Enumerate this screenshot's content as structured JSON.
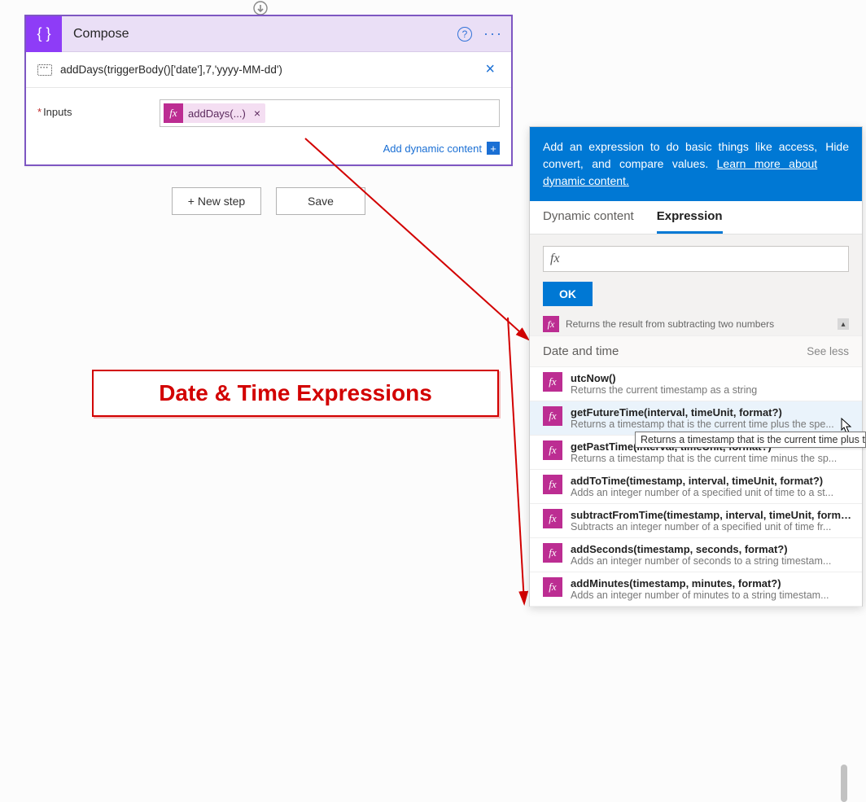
{
  "connector_symbol": "⇣",
  "compose_card": {
    "title": "Compose",
    "help_icon": "?",
    "ellipsis": "···",
    "expression_preview": "addDays(triggerBody()['date'],7,'yyyy-MM-dd')",
    "close_x": "×",
    "input_label": "Inputs",
    "required_marker": "*",
    "chip_text": "addDays(...)",
    "chip_x": "×",
    "dynamic_link_text": "Add dynamic content",
    "dynamic_plus": "+"
  },
  "buttons": {
    "new_step": "+ New step",
    "save": "Save"
  },
  "annotation": {
    "text": "Date & Time Expressions"
  },
  "panel": {
    "header_text_1": "Add an expression to do basic things like access, convert, and compare values. ",
    "learn_link": "Learn more about dynamic content.",
    "hide": "Hide",
    "tabs": {
      "dynamic": "Dynamic content",
      "expression": "Expression"
    },
    "input_prefix": "fx",
    "input_value": "",
    "ok": "OK",
    "partial_row_desc": "Returns the result from subtracting two numbers",
    "scroll_up_glyph": "▴",
    "category": {
      "name": "Date and time",
      "action": "See less"
    },
    "functions": [
      {
        "name": "utcNow()",
        "desc": "Returns the current timestamp as a string"
      },
      {
        "name": "getFutureTime(interval, timeUnit, format?)",
        "desc": "Returns a timestamp that is the current time plus the spe..."
      },
      {
        "name": "getPastTime(interval, timeUnit, format?)",
        "desc": "Returns a timestamp that is the current time minus the sp..."
      },
      {
        "name": "addToTime(timestamp, interval, timeUnit, format?)",
        "desc": "Adds an integer number of a specified unit of time to a st..."
      },
      {
        "name": "subtractFromTime(timestamp, interval, timeUnit, forma...",
        "desc": "Subtracts an integer number of a specified unit of time fr..."
      },
      {
        "name": "addSeconds(timestamp, seconds, format?)",
        "desc": "Adds an integer number of seconds to a string timestam..."
      },
      {
        "name": "addMinutes(timestamp, minutes, format?)",
        "desc": "Adds an integer number of minutes to a string timestam..."
      }
    ],
    "tooltip": "Returns a timestamp that is the current time plus the"
  }
}
